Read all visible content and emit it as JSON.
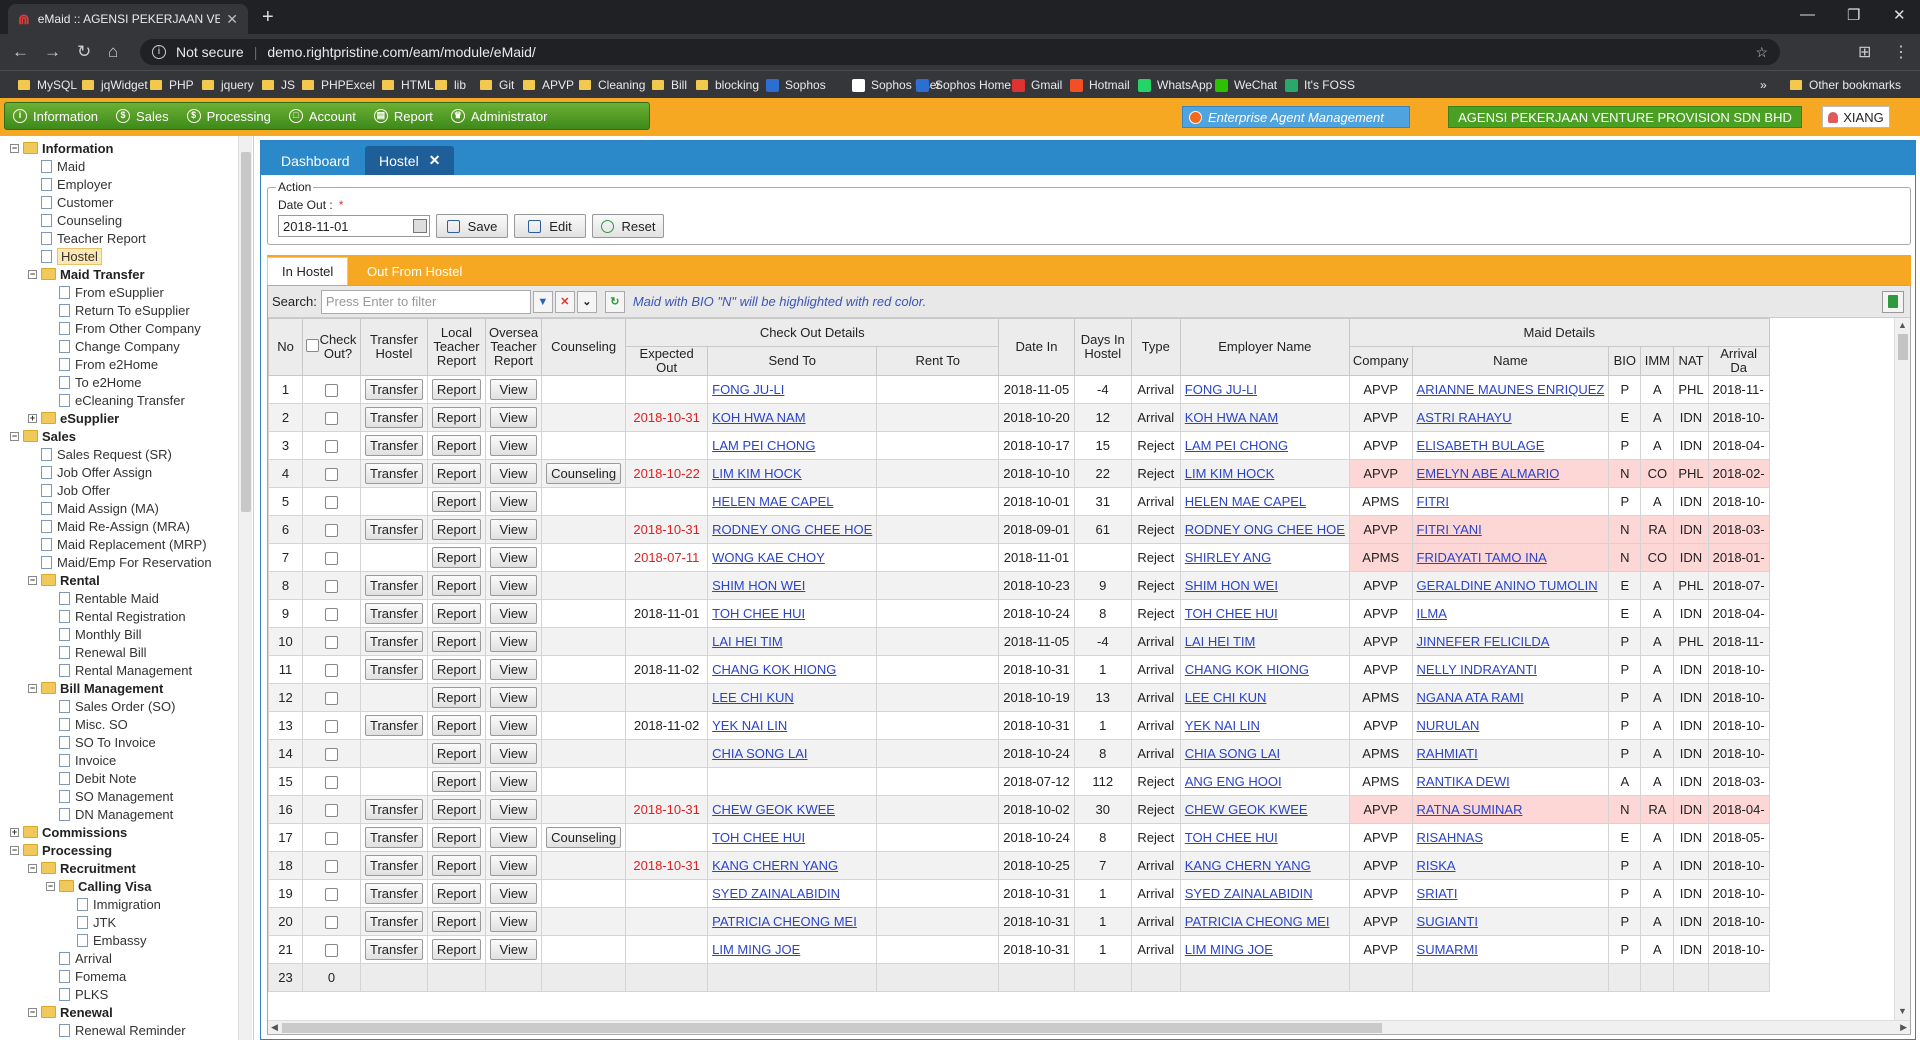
{
  "browser": {
    "tab_title": "eMaid :: AGENSI PEKERJAAN VEN",
    "security_label": "Not secure",
    "url": "demo.rightpristine.com/eam/module/eMaid/",
    "bookmarks": [
      "MySQL",
      "jqWidget",
      "PHP",
      "jquery",
      "JS",
      "PHPExcel",
      "HTML",
      "lib",
      "Git",
      "APVP",
      "Cleaning",
      "Bill",
      "blocking",
      "Sophos",
      "Sophos User",
      "Sophos Home",
      "Gmail",
      "Hotmail",
      "WhatsApp",
      "WeChat",
      "It's FOSS"
    ],
    "other_bookmarks": "Other bookmarks"
  },
  "menu": [
    "Information",
    "Sales",
    "Processing",
    "Account",
    "Report",
    "Administrator"
  ],
  "header": {
    "eam": "Enterprise Agent Management",
    "company": "AGENSI PEKERJAAN VENTURE PROVISION SDN BHD",
    "user": "XIANG"
  },
  "sidebar": [
    {
      "label": "Information",
      "type": "folder",
      "level": 0,
      "toggle": "−"
    },
    {
      "label": "Maid",
      "type": "doc",
      "level": 1
    },
    {
      "label": "Employer",
      "type": "doc",
      "level": 1
    },
    {
      "label": "Customer",
      "type": "doc",
      "level": 1
    },
    {
      "label": "Counseling",
      "type": "doc",
      "level": 1
    },
    {
      "label": "Teacher Report",
      "type": "doc",
      "level": 1
    },
    {
      "label": "Hostel",
      "type": "doc",
      "level": 1,
      "selected": true
    },
    {
      "label": "Maid Transfer",
      "type": "folder",
      "level": 1,
      "toggle": "−"
    },
    {
      "label": "From eSupplier",
      "type": "doc",
      "level": 2
    },
    {
      "label": "Return To eSupplier",
      "type": "doc",
      "level": 2
    },
    {
      "label": "From Other Company",
      "type": "doc",
      "level": 2
    },
    {
      "label": "Change Company",
      "type": "doc",
      "level": 2
    },
    {
      "label": "From e2Home",
      "type": "doc",
      "level": 2
    },
    {
      "label": "To e2Home",
      "type": "doc",
      "level": 2
    },
    {
      "label": "eCleaning Transfer",
      "type": "doc",
      "level": 2
    },
    {
      "label": "eSupplier",
      "type": "folder",
      "level": 1,
      "toggle": "+"
    },
    {
      "label": "Sales",
      "type": "folder",
      "level": 0,
      "toggle": "−"
    },
    {
      "label": "Sales Request (SR)",
      "type": "doc",
      "level": 1
    },
    {
      "label": "Job Offer Assign",
      "type": "doc",
      "level": 1
    },
    {
      "label": "Job Offer",
      "type": "doc",
      "level": 1
    },
    {
      "label": "Maid Assign (MA)",
      "type": "doc",
      "level": 1
    },
    {
      "label": "Maid Re-Assign (MRA)",
      "type": "doc",
      "level": 1
    },
    {
      "label": "Maid Replacement (MRP)",
      "type": "doc",
      "level": 1
    },
    {
      "label": "Maid/Emp For Reservation",
      "type": "doc",
      "level": 1
    },
    {
      "label": "Rental",
      "type": "folder",
      "level": 1,
      "toggle": "−"
    },
    {
      "label": "Rentable Maid",
      "type": "doc",
      "level": 2
    },
    {
      "label": "Rental Registration",
      "type": "doc",
      "level": 2
    },
    {
      "label": "Monthly Bill",
      "type": "doc",
      "level": 2
    },
    {
      "label": "Renewal Bill",
      "type": "doc",
      "level": 2
    },
    {
      "label": "Rental Management",
      "type": "doc",
      "level": 2
    },
    {
      "label": "Bill Management",
      "type": "folder",
      "level": 1,
      "toggle": "−"
    },
    {
      "label": "Sales Order (SO)",
      "type": "doc",
      "level": 2
    },
    {
      "label": "Misc. SO",
      "type": "doc",
      "level": 2
    },
    {
      "label": "SO To Invoice",
      "type": "doc",
      "level": 2
    },
    {
      "label": "Invoice",
      "type": "doc",
      "level": 2
    },
    {
      "label": "Debit Note",
      "type": "doc",
      "level": 2
    },
    {
      "label": "SO Management",
      "type": "doc",
      "level": 2
    },
    {
      "label": "DN Management",
      "type": "doc",
      "level": 2
    },
    {
      "label": "Commissions",
      "type": "folder",
      "level": 0,
      "toggle": "+"
    },
    {
      "label": "Processing",
      "type": "folder",
      "level": 0,
      "toggle": "−"
    },
    {
      "label": "Recruitment",
      "type": "folder",
      "level": 1,
      "toggle": "−"
    },
    {
      "label": "Calling Visa",
      "type": "folder",
      "level": 2,
      "toggle": "−"
    },
    {
      "label": "Immigration",
      "type": "doc",
      "level": 3
    },
    {
      "label": "JTK",
      "type": "doc",
      "level": 3
    },
    {
      "label": "Embassy",
      "type": "doc",
      "level": 3
    },
    {
      "label": "Arrival",
      "type": "doc",
      "level": 2
    },
    {
      "label": "Fomema",
      "type": "doc",
      "level": 2
    },
    {
      "label": "PLKS",
      "type": "doc",
      "level": 2
    },
    {
      "label": "Renewal",
      "type": "folder",
      "level": 1,
      "toggle": "−"
    },
    {
      "label": "Renewal Reminder",
      "type": "doc",
      "level": 2
    }
  ],
  "content_tabs": [
    {
      "label": "Dashboard",
      "active": false
    },
    {
      "label": "Hostel",
      "active": true
    }
  ],
  "action": {
    "legend": "Action",
    "date_out_label": "Date Out :",
    "required_mark": "*",
    "date_out_value": "2018-11-01",
    "save": "Save",
    "edit": "Edit",
    "reset": "Reset"
  },
  "subtabs": [
    {
      "label": "In Hostel",
      "active": true
    },
    {
      "label": "Out From Hostel",
      "active": false
    }
  ],
  "search": {
    "label": "Search:",
    "placeholder": "Press Enter to filter",
    "hint": "Maid with BIO \"N\" will be highlighted with red color."
  },
  "columns": {
    "no": "No",
    "check_out": "Check Out?",
    "transfer": "Transfer Hostel",
    "local_report": "Local Teacher Report",
    "oversea_report": "Oversea Teacher Report",
    "counseling": "Counseling",
    "checkout_group": "Check Out Details",
    "expected_out": "Expected Out",
    "send_to": "Send To",
    "rent_to": "Rent To",
    "date_in": "Date In",
    "days_in": "Days In Hostel",
    "type": "Type",
    "employer": "Employer Name",
    "maid_group": "Maid Details",
    "company": "Company",
    "name": "Name",
    "bio": "BIO",
    "imm": "IMM",
    "nat": "NAT",
    "arrival": "Arrival Da"
  },
  "button_labels": {
    "transfer": "Transfer",
    "report": "Report",
    "view": "View",
    "counseling": "Counseling"
  },
  "rows": [
    {
      "no": "1",
      "transfer": true,
      "counseling": false,
      "expected": "",
      "expected_red": false,
      "send_to": "FONG JU-LI",
      "rent_to": "",
      "date_in": "2018-11-05",
      "days": "-4",
      "type": "Arrival",
      "employer": "FONG JU-LI",
      "company": "APVP",
      "name": "ARIANNE MAUNES ENRIQUEZ",
      "bio": "P",
      "imm": "A",
      "nat": "PHL",
      "arrival": "2018-11-",
      "pink": false
    },
    {
      "no": "2",
      "transfer": true,
      "counseling": false,
      "expected": "2018-10-31",
      "expected_red": true,
      "send_to": "KOH HWA NAM",
      "rent_to": "",
      "date_in": "2018-10-20",
      "days": "12",
      "type": "Arrival",
      "employer": "KOH HWA NAM",
      "company": "APVP",
      "name": "ASTRI RAHAYU",
      "bio": "E",
      "imm": "A",
      "nat": "IDN",
      "arrival": "2018-10-",
      "pink": false
    },
    {
      "no": "3",
      "transfer": true,
      "counseling": false,
      "expected": "",
      "expected_red": false,
      "send_to": "LAM PEI CHONG",
      "rent_to": "",
      "date_in": "2018-10-17",
      "days": "15",
      "type": "Reject",
      "employer": "LAM PEI CHONG",
      "company": "APVP",
      "name": "ELISABETH BULAGE",
      "bio": "P",
      "imm": "A",
      "nat": "IDN",
      "arrival": "2018-04-",
      "pink": false
    },
    {
      "no": "4",
      "transfer": true,
      "counseling": true,
      "expected": "2018-10-22",
      "expected_red": true,
      "send_to": "LIM KIM HOCK",
      "rent_to": "",
      "date_in": "2018-10-10",
      "days": "22",
      "type": "Reject",
      "employer": "LIM KIM HOCK",
      "company": "APVP",
      "name": "EMELYN ABE ALMARIO",
      "bio": "N",
      "imm": "CO",
      "nat": "PHL",
      "arrival": "2018-02-",
      "pink": true
    },
    {
      "no": "5",
      "transfer": false,
      "counseling": false,
      "expected": "",
      "expected_red": false,
      "send_to": "HELEN MAE CAPEL",
      "rent_to": "",
      "date_in": "2018-10-01",
      "days": "31",
      "type": "Arrival",
      "employer": "HELEN MAE CAPEL",
      "company": "APMS",
      "name": "FITRI",
      "bio": "P",
      "imm": "A",
      "nat": "IDN",
      "arrival": "2018-10-",
      "pink": false
    },
    {
      "no": "6",
      "transfer": true,
      "counseling": false,
      "expected": "2018-10-31",
      "expected_red": true,
      "send_to": "RODNEY ONG CHEE HOE",
      "rent_to": "",
      "date_in": "2018-09-01",
      "days": "61",
      "type": "Reject",
      "employer": "RODNEY ONG CHEE HOE",
      "company": "APVP",
      "name": "FITRI YANI",
      "bio": "N",
      "imm": "RA",
      "nat": "IDN",
      "arrival": "2018-03-",
      "pink": true
    },
    {
      "no": "7",
      "transfer": false,
      "counseling": false,
      "expected": "2018-07-11",
      "expected_red": true,
      "send_to": "WONG KAE CHOY",
      "rent_to": "",
      "date_in": "2018-11-01",
      "days": "",
      "type": "Reject",
      "employer": "SHIRLEY ANG",
      "company": "APMS",
      "name": "FRIDAYATI TAMO INA",
      "bio": "N",
      "imm": "CO",
      "nat": "IDN",
      "arrival": "2018-01-",
      "pink": true
    },
    {
      "no": "8",
      "transfer": true,
      "counseling": false,
      "expected": "",
      "expected_red": false,
      "send_to": "SHIM HON WEI",
      "rent_to": "",
      "date_in": "2018-10-23",
      "days": "9",
      "type": "Reject",
      "employer": "SHIM HON WEI",
      "company": "APVP",
      "name": "GERALDINE ANINO TUMOLIN",
      "bio": "E",
      "imm": "A",
      "nat": "PHL",
      "arrival": "2018-07-",
      "pink": false
    },
    {
      "no": "9",
      "transfer": true,
      "counseling": false,
      "expected": "2018-11-01",
      "expected_red": false,
      "send_to": "TOH CHEE HUI",
      "rent_to": "",
      "date_in": "2018-10-24",
      "days": "8",
      "type": "Reject",
      "employer": "TOH CHEE HUI",
      "company": "APVP",
      "name": "ILMA",
      "bio": "E",
      "imm": "A",
      "nat": "IDN",
      "arrival": "2018-04-",
      "pink": false
    },
    {
      "no": "10",
      "transfer": true,
      "counseling": false,
      "expected": "",
      "expected_red": false,
      "send_to": "LAI HEI TIM",
      "rent_to": "",
      "date_in": "2018-11-05",
      "days": "-4",
      "type": "Arrival",
      "employer": "LAI HEI TIM",
      "company": "APVP",
      "name": "JINNEFER FELICILDA",
      "bio": "P",
      "imm": "A",
      "nat": "PHL",
      "arrival": "2018-11-",
      "pink": false
    },
    {
      "no": "11",
      "transfer": true,
      "counseling": false,
      "expected": "2018-11-02",
      "expected_red": false,
      "send_to": "CHANG KOK HIONG",
      "rent_to": "",
      "date_in": "2018-10-31",
      "days": "1",
      "type": "Arrival",
      "employer": "CHANG KOK HIONG",
      "company": "APVP",
      "name": "NELLY INDRAYANTI",
      "bio": "P",
      "imm": "A",
      "nat": "IDN",
      "arrival": "2018-10-",
      "pink": false
    },
    {
      "no": "12",
      "transfer": false,
      "counseling": false,
      "expected": "",
      "expected_red": false,
      "send_to": "LEE CHI KUN",
      "rent_to": "",
      "date_in": "2018-10-19",
      "days": "13",
      "type": "Arrival",
      "employer": "LEE CHI KUN",
      "company": "APMS",
      "name": "NGANA ATA RAMI",
      "bio": "P",
      "imm": "A",
      "nat": "IDN",
      "arrival": "2018-10-",
      "pink": false
    },
    {
      "no": "13",
      "transfer": true,
      "counseling": false,
      "expected": "2018-11-02",
      "expected_red": false,
      "send_to": "YEK NAI LIN",
      "rent_to": "",
      "date_in": "2018-10-31",
      "days": "1",
      "type": "Arrival",
      "employer": "YEK NAI LIN",
      "company": "APVP",
      "name": "NURULAN",
      "bio": "P",
      "imm": "A",
      "nat": "IDN",
      "arrival": "2018-10-",
      "pink": false
    },
    {
      "no": "14",
      "transfer": false,
      "counseling": false,
      "expected": "",
      "expected_red": false,
      "send_to": "CHIA SONG LAI",
      "rent_to": "",
      "date_in": "2018-10-24",
      "days": "8",
      "type": "Arrival",
      "employer": "CHIA SONG LAI",
      "company": "APMS",
      "name": "RAHMIATI",
      "bio": "P",
      "imm": "A",
      "nat": "IDN",
      "arrival": "2018-10-",
      "pink": false
    },
    {
      "no": "15",
      "transfer": false,
      "counseling": false,
      "expected": "",
      "expected_red": false,
      "send_to": "",
      "rent_to": "",
      "date_in": "2018-07-12",
      "days": "112",
      "type": "Reject",
      "employer": "ANG ENG HOOI",
      "company": "APMS",
      "name": "RANTIKA DEWI",
      "bio": "A",
      "imm": "A",
      "nat": "IDN",
      "arrival": "2018-03-",
      "pink": false
    },
    {
      "no": "16",
      "transfer": true,
      "counseling": false,
      "expected": "2018-10-31",
      "expected_red": true,
      "send_to": "CHEW GEOK KWEE",
      "rent_to": "",
      "date_in": "2018-10-02",
      "days": "30",
      "type": "Reject",
      "employer": "CHEW GEOK KWEE",
      "company": "APVP",
      "name": "RATNA SUMINAR",
      "bio": "N",
      "imm": "RA",
      "nat": "IDN",
      "arrival": "2018-04-",
      "pink": true
    },
    {
      "no": "17",
      "transfer": true,
      "counseling": true,
      "expected": "",
      "expected_red": false,
      "send_to": "TOH CHEE HUI",
      "rent_to": "",
      "date_in": "2018-10-24",
      "days": "8",
      "type": "Reject",
      "employer": "TOH CHEE HUI",
      "company": "APVP",
      "name": "RISAHNAS",
      "bio": "E",
      "imm": "A",
      "nat": "IDN",
      "arrival": "2018-05-",
      "pink": false
    },
    {
      "no": "18",
      "transfer": true,
      "counseling": false,
      "expected": "2018-10-31",
      "expected_red": true,
      "send_to": "KANG CHERN YANG",
      "rent_to": "",
      "date_in": "2018-10-25",
      "days": "7",
      "type": "Arrival",
      "employer": "KANG CHERN YANG",
      "company": "APVP",
      "name": "RISKA",
      "bio": "P",
      "imm": "A",
      "nat": "IDN",
      "arrival": "2018-10-",
      "pink": false
    },
    {
      "no": "19",
      "transfer": true,
      "counseling": false,
      "expected": "",
      "expected_red": false,
      "send_to": "SYED ZAINALABIDIN",
      "rent_to": "",
      "date_in": "2018-10-31",
      "days": "1",
      "type": "Arrival",
      "employer": "SYED ZAINALABIDIN",
      "company": "APVP",
      "name": "SRIATI",
      "bio": "P",
      "imm": "A",
      "nat": "IDN",
      "arrival": "2018-10-",
      "pink": false
    },
    {
      "no": "20",
      "transfer": true,
      "counseling": false,
      "expected": "",
      "expected_red": false,
      "send_to": "PATRICIA CHEONG MEI",
      "rent_to": "",
      "date_in": "2018-10-31",
      "days": "1",
      "type": "Arrival",
      "employer": "PATRICIA CHEONG MEI",
      "company": "APVP",
      "name": "SUGIANTI",
      "bio": "P",
      "imm": "A",
      "nat": "IDN",
      "arrival": "2018-10-",
      "pink": false
    },
    {
      "no": "21",
      "transfer": true,
      "counseling": false,
      "expected": "",
      "expected_red": false,
      "send_to": "LIM MING JOE",
      "rent_to": "",
      "date_in": "2018-10-31",
      "days": "1",
      "type": "Arrival",
      "employer": "LIM MING JOE",
      "company": "APVP",
      "name": "SUMARMI",
      "bio": "P",
      "imm": "A",
      "nat": "IDN",
      "arrival": "2018-10-",
      "pink": false
    }
  ],
  "footer": {
    "count": "23",
    "checked": "0"
  }
}
